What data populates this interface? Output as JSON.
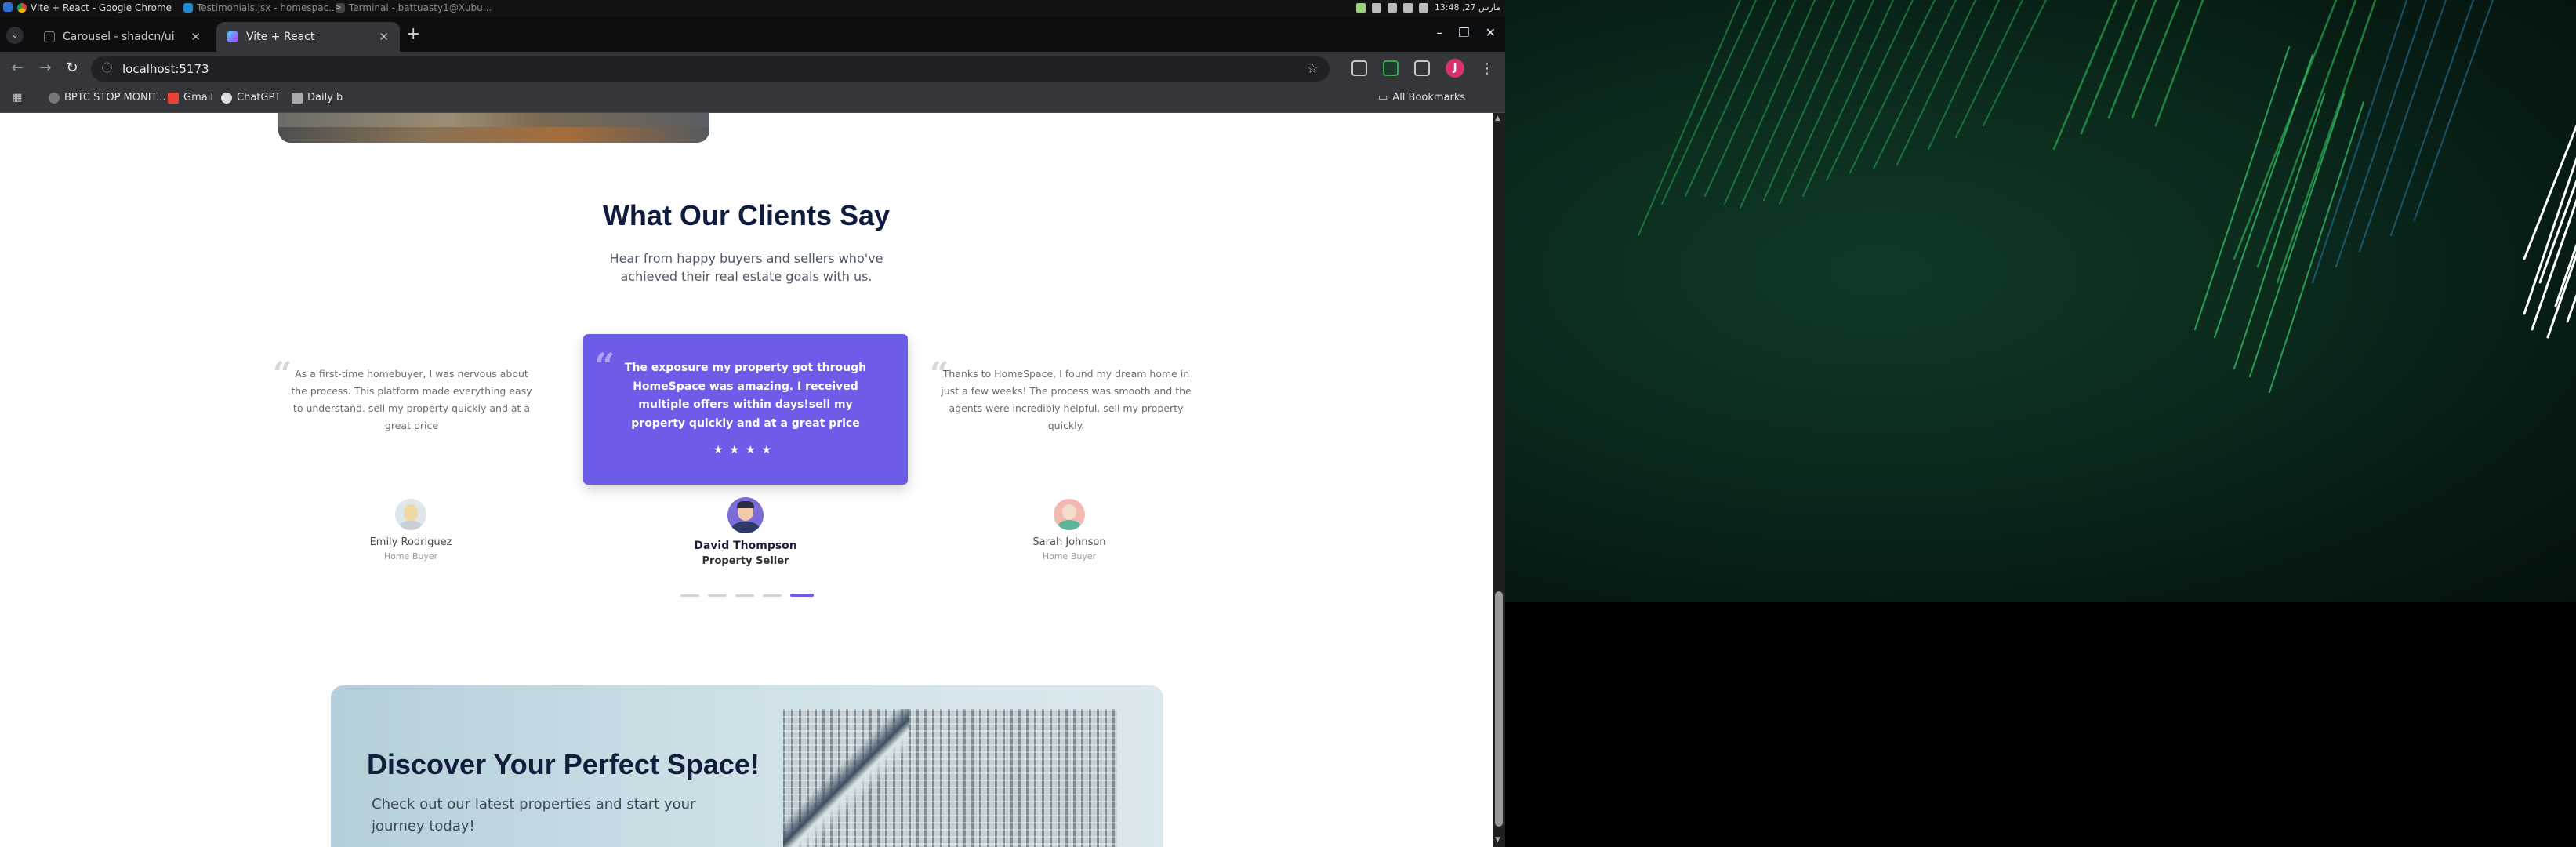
{
  "system_bar": {
    "apps": [
      {
        "label": "Vite + React - Google Chrome",
        "icon": "chrome-icon"
      },
      {
        "label": "Testimonials.jsx - homespac...",
        "icon": "vscode-icon"
      },
      {
        "label": "Terminal - battuasty1@Xubu...",
        "icon": "terminal-icon"
      }
    ],
    "clock": "13:48 ,مارس 27"
  },
  "browser": {
    "tabs": [
      {
        "label": "Carousel - shadcn/ui",
        "active": false
      },
      {
        "label": "Vite + React",
        "active": true
      }
    ],
    "url": "localhost:5173",
    "profile_initial": "J",
    "bookmarks": [
      {
        "label": "BPTC STOP MONIT...",
        "icon": "globe-icon"
      },
      {
        "label": "Gmail",
        "icon": "gmail-icon"
      },
      {
        "label": "ChatGPT",
        "icon": "chatgpt-icon"
      },
      {
        "label": "Daily b",
        "icon": "daily-icon"
      }
    ],
    "all_bookmarks": "All Bookmarks"
  },
  "testimonials": {
    "title": "What Our Clients Say",
    "subtitle": "Hear from happy buyers and sellers who've achieved their real estate goals with us.",
    "quotes": {
      "left": "As a first-time homebuyer, I was nervous about the process. This platform made everything easy to understand. sell my property quickly and at a great price",
      "center": "The exposure my property got through HomeSpace was amazing. I received multiple offers within days!sell my property quickly and at a great price",
      "right": "Thanks to HomeSpace, I found my dream home in just a few weeks! The process was smooth and the agents were incredibly helpful. sell my property quickly."
    },
    "stars": "★★★★",
    "people": [
      {
        "name": "Emily Rodriguez",
        "role": "Home Buyer"
      },
      {
        "name": "David Thompson",
        "role": "Property Seller"
      },
      {
        "name": "Sarah Johnson",
        "role": "Home Buyer"
      }
    ],
    "dots_total": 5,
    "active_dot": 5
  },
  "banner": {
    "title": "Discover Your Perfect Space!",
    "text": "Check out our latest properties and start your journey today!"
  },
  "colors": {
    "accent": "#6c5ce7",
    "heading": "#0f1c3f"
  }
}
